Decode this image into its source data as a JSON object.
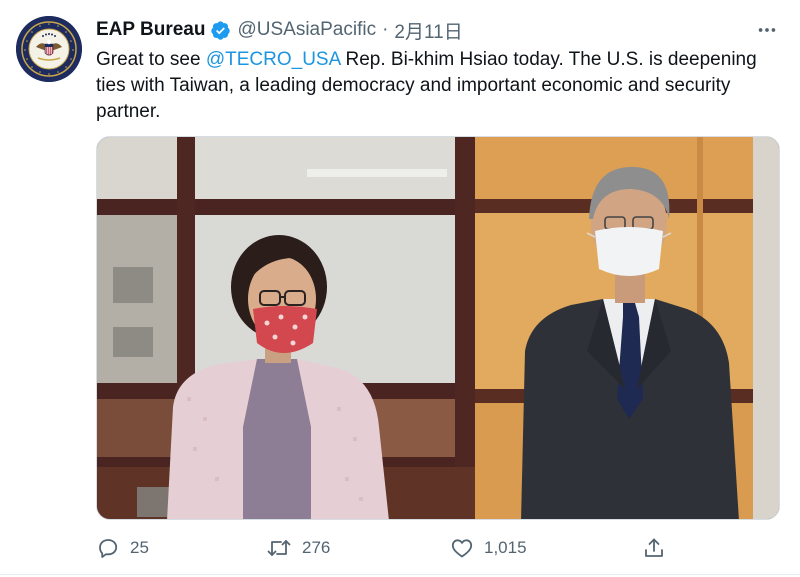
{
  "tweet": {
    "display_name": "EAP Bureau",
    "handle": "@USAsiaPacific",
    "separator": "·",
    "date": "2月11日",
    "text_before": "Great to see ",
    "mention": "@TECRO_USA",
    "text_after": " Rep. Bi-khim Hsiao today. The U.S. is deepening ties with Taiwan, a leading democracy and important economic and security partner.",
    "verified": true
  },
  "actions": {
    "reply_count": "25",
    "retweet_count": "276",
    "like_count": "1,015"
  },
  "icons": {
    "avatar": "department-of-state-seal",
    "verified": "verified-badge-icon",
    "more": "more-horizontal-icon",
    "reply": "reply-icon",
    "retweet": "retweet-icon",
    "like": "heart-icon",
    "share": "share-icon"
  },
  "colors": {
    "mention": "#1b95e0",
    "verified_badge": "#1d9bf0",
    "secondary_text": "#536471"
  }
}
